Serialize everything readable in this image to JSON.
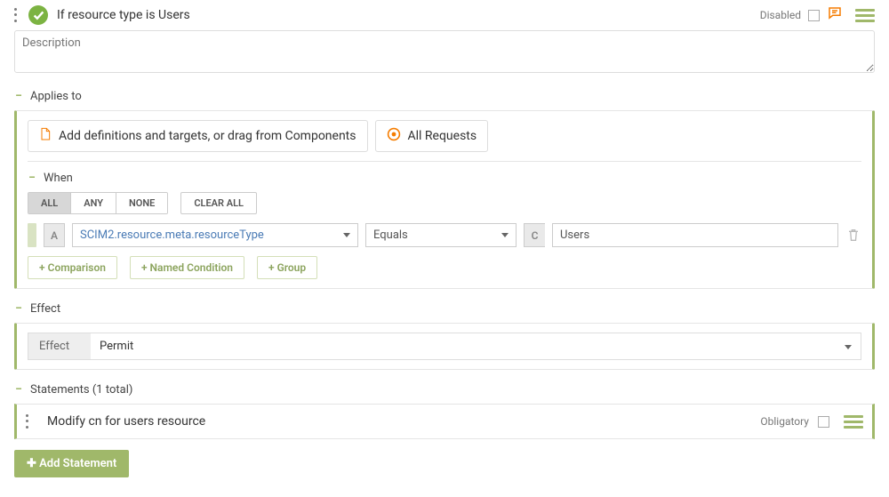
{
  "header": {
    "title": "If resource type is Users",
    "disabled_label": "Disabled"
  },
  "description": {
    "placeholder": "Description"
  },
  "sections": {
    "applies_to": {
      "title": "Applies to",
      "cta_definitions": "Add definitions and targets, or drag from Components",
      "cta_all_requests": "All Requests",
      "when_label": "When",
      "seg": {
        "all": "ALL",
        "any": "ANY",
        "none": "NONE"
      },
      "clear": "CLEAR ALL",
      "condition": {
        "left_chip": "A",
        "attribute": "SCIM2.resource.meta.resourceType",
        "operator": "Equals",
        "right_chip": "C",
        "value": "Users"
      },
      "add": {
        "comparison": "Comparison",
        "named": "Named Condition",
        "group": "Group"
      }
    },
    "effect": {
      "title": "Effect",
      "label": "Effect",
      "value": "Permit"
    },
    "statements": {
      "title": "Statements (1 total)",
      "items": [
        {
          "title": "Modify cn for users resource",
          "obligatory_label": "Obligatory"
        }
      ],
      "add_button": "Add Statement"
    }
  }
}
